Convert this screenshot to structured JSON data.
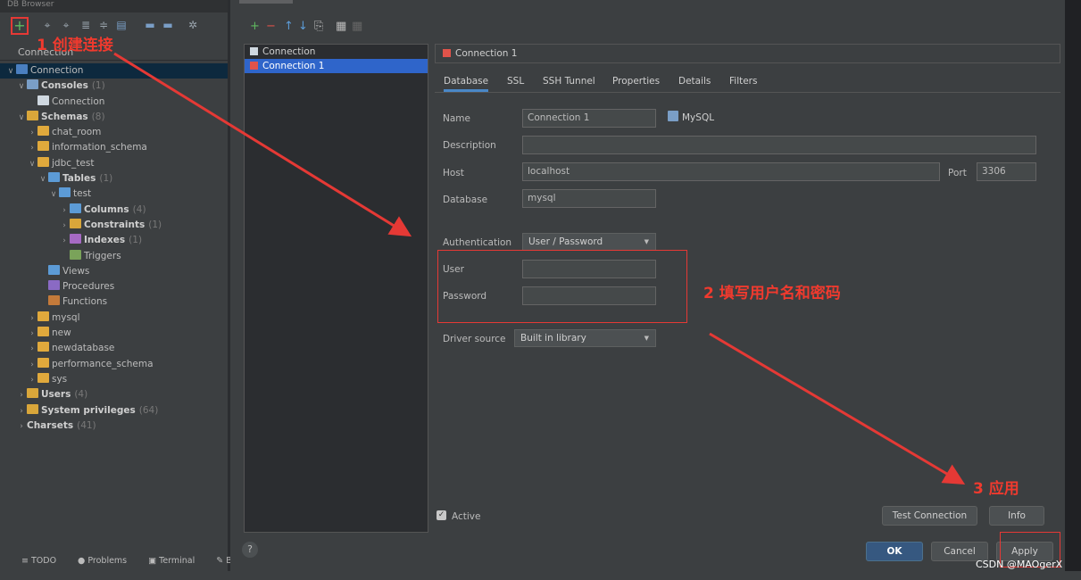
{
  "left_panel": {
    "top_title": "DB Browser",
    "caption": "Connection",
    "tree": [
      {
        "label": "Connection",
        "count": "",
        "depth": 0,
        "arrow": "down",
        "icon": "#4a7fc0",
        "bold": false,
        "selected": true
      },
      {
        "label": "Consoles",
        "count": "(1)",
        "depth": 1,
        "arrow": "down",
        "icon": "#7a9ec6",
        "bold": true
      },
      {
        "label": "Connection",
        "count": "",
        "depth": 2,
        "arrow": "",
        "icon": "#cfd8e0",
        "bold": false
      },
      {
        "label": "Schemas",
        "count": "(8)",
        "depth": 1,
        "arrow": "down",
        "icon": "#d9a63a",
        "bold": true
      },
      {
        "label": "chat_room",
        "count": "",
        "depth": 2,
        "arrow": "right",
        "icon": "#e0a93c",
        "bold": false
      },
      {
        "label": "information_schema",
        "count": "",
        "depth": 2,
        "arrow": "right",
        "icon": "#e0a93c",
        "bold": false
      },
      {
        "label": "jdbc_test",
        "count": "",
        "depth": 2,
        "arrow": "down",
        "icon": "#e0a93c",
        "bold": false
      },
      {
        "label": "Tables",
        "count": "(1)",
        "depth": 3,
        "arrow": "down",
        "icon": "#5c9bd6",
        "bold": true
      },
      {
        "label": "test",
        "count": "",
        "depth": 4,
        "arrow": "down",
        "icon": "#5c9bd6",
        "bold": false
      },
      {
        "label": "Columns",
        "count": "(4)",
        "depth": 5,
        "arrow": "right",
        "icon": "#5c9bd6",
        "bold": true
      },
      {
        "label": "Constraints",
        "count": "(1)",
        "depth": 5,
        "arrow": "right",
        "icon": "#d9a63a",
        "bold": true
      },
      {
        "label": "Indexes",
        "count": "(1)",
        "depth": 5,
        "arrow": "right",
        "icon": "#a66ac4",
        "bold": true
      },
      {
        "label": "Triggers",
        "count": "",
        "depth": 5,
        "arrow": "",
        "icon": "#7aa35a",
        "bold": false
      },
      {
        "label": "Views",
        "count": "",
        "depth": 3,
        "arrow": "",
        "icon": "#5c9bd6",
        "bold": false
      },
      {
        "label": "Procedures",
        "count": "",
        "depth": 3,
        "arrow": "",
        "icon": "#8a6ac4",
        "bold": false
      },
      {
        "label": "Functions",
        "count": "",
        "depth": 3,
        "arrow": "",
        "icon": "#c47a3a",
        "bold": false
      },
      {
        "label": "mysql",
        "count": "",
        "depth": 2,
        "arrow": "right",
        "icon": "#e0a93c",
        "bold": false
      },
      {
        "label": "new",
        "count": "",
        "depth": 2,
        "arrow": "right",
        "icon": "#e0a93c",
        "bold": false
      },
      {
        "label": "newdatabase",
        "count": "",
        "depth": 2,
        "arrow": "right",
        "icon": "#e0a93c",
        "bold": false
      },
      {
        "label": "performance_schema",
        "count": "",
        "depth": 2,
        "arrow": "right",
        "icon": "#e0a93c",
        "bold": false
      },
      {
        "label": "sys",
        "count": "",
        "depth": 2,
        "arrow": "right",
        "icon": "#e0a93c",
        "bold": false
      },
      {
        "label": "Users",
        "count": "(4)",
        "depth": 1,
        "arrow": "right",
        "icon": "#d9a63a",
        "bold": true
      },
      {
        "label": "System privileges",
        "count": "(64)",
        "depth": 1,
        "arrow": "right",
        "icon": "#d9a63a",
        "bold": true
      },
      {
        "label": "Charsets",
        "count": "(41)",
        "depth": 1,
        "arrow": "right",
        "icon": "",
        "bold": true
      }
    ],
    "status_items": [
      {
        "icon": "≡",
        "label": "TODO"
      },
      {
        "icon": "●",
        "label": "Problems"
      },
      {
        "icon": "▣",
        "label": "Terminal"
      },
      {
        "icon": "✎",
        "label": "Build"
      }
    ]
  },
  "dialog": {
    "connections": [
      "Connection",
      "Connection 1"
    ],
    "header_title": "Connection 1",
    "tabs": [
      "Database",
      "SSL",
      "SSH Tunnel",
      "Properties",
      "Details",
      "Filters"
    ],
    "form": {
      "name_label": "Name",
      "name_value": "Connection 1",
      "db_type": "MySQL",
      "description_label": "Description",
      "description_value": "",
      "host_label": "Host",
      "host_value": "localhost",
      "port_label": "Port",
      "port_value": "3306",
      "database_label": "Database",
      "database_value": "mysql",
      "auth_label": "Authentication",
      "auth_value": "User / Password",
      "user_label": "User",
      "user_value": "",
      "password_label": "Password",
      "password_value": "",
      "driver_label": "Driver source",
      "driver_value": "Built in library"
    },
    "active_label": "Active",
    "buttons": {
      "test": "Test Connection",
      "info": "Info",
      "ok": "OK",
      "cancel": "Cancel",
      "apply": "Apply"
    }
  },
  "annotations": {
    "step1": "1 创建连接",
    "step2": "2 填写用户名和密码",
    "step3": "3 应用"
  },
  "watermark": "CSDN @MAOgerX",
  "colors": {
    "accent_red": "#e53935",
    "selection": "#2f65ca",
    "tab_underline": "#4a88c7"
  }
}
